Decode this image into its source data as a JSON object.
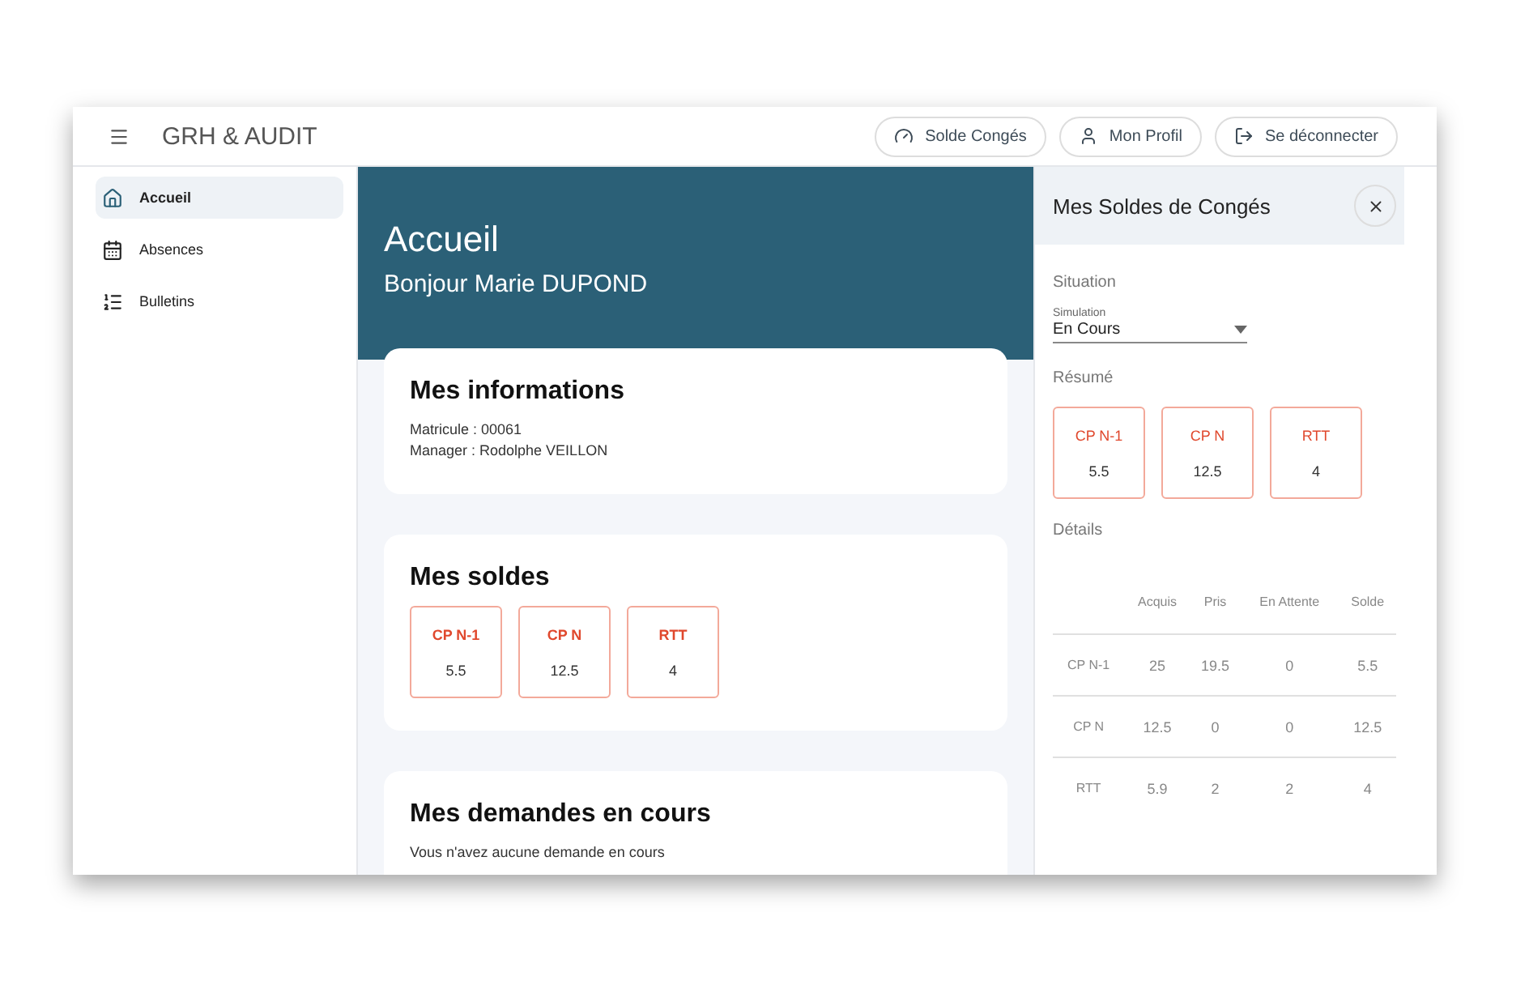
{
  "header": {
    "title": "GRH & AUDIT",
    "buttons": [
      {
        "label": "Solde Congés",
        "kind": "gauge"
      },
      {
        "label": "Mon Profil",
        "kind": "user"
      },
      {
        "label": "Se déconnecter",
        "kind": "logout"
      }
    ]
  },
  "sidebar": {
    "items": [
      {
        "label": "Accueil",
        "kind": "home",
        "selected": true
      },
      {
        "label": "Absences",
        "kind": "calendar",
        "selected": false
      },
      {
        "label": "Bulletins",
        "kind": "list",
        "selected": false
      }
    ]
  },
  "main": {
    "title": "Accueil",
    "greeting": "Bonjour Marie DUPOND",
    "info": {
      "title": "Mes informations",
      "lines": [
        "Matricule : 00061",
        "Manager : Rodolphe VEILLON"
      ]
    },
    "balances": {
      "title": "Mes soldes",
      "items": [
        {
          "label": "CP N-1",
          "value": "5.5"
        },
        {
          "label": "CP N",
          "value": "12.5"
        },
        {
          "label": "RTT",
          "value": "4"
        }
      ]
    },
    "requests": {
      "title": "Mes demandes en cours",
      "message": "Vous n'avez aucune demande en cours"
    }
  },
  "panel": {
    "title": "Mes Soldes de Congés",
    "situation_label": "Situation",
    "select": {
      "label": "Simulation",
      "value": "En Cours"
    },
    "summary_label": "Résumé",
    "summary": [
      {
        "label": "CP N-1",
        "value": "5.5"
      },
      {
        "label": "CP N",
        "value": "12.5"
      },
      {
        "label": "RTT",
        "value": "4"
      }
    ],
    "details_label": "Détails",
    "table": {
      "columns": [
        "Acquis",
        "Pris",
        "En Attente",
        "Solde"
      ],
      "rows": [
        {
          "label": "CP N-1",
          "cells": [
            "25",
            "19.5",
            "0",
            "5.5"
          ]
        },
        {
          "label": "CP N",
          "cells": [
            "12.5",
            "0",
            "0",
            "12.5"
          ]
        },
        {
          "label": "RTT",
          "cells": [
            "5.9",
            "2",
            "2",
            "4"
          ]
        }
      ]
    }
  }
}
